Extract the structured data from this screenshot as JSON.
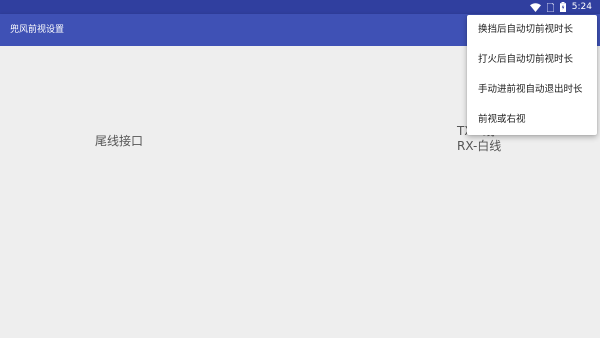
{
  "status_bar": {
    "time": "5:24",
    "icons": [
      "wifi-icon",
      "sim-icon",
      "battery-icon"
    ]
  },
  "app_bar": {
    "title": "兜风前视设置",
    "color": "#3f51b5",
    "status_color": "#303f9f"
  },
  "content": {
    "label_left": "尾线接口",
    "label_right_line1": "TX-?线",
    "label_right_line2": "RX-白线"
  },
  "menu": {
    "items": [
      "换挡后自动切前视时长",
      "打火后自动切前视时长",
      "手动进前视自动退出时长",
      "前视或右视"
    ]
  }
}
